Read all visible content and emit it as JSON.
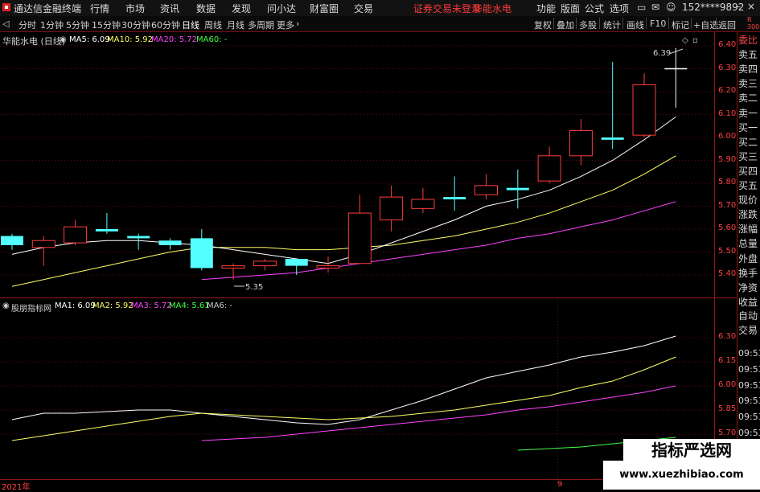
{
  "app": {
    "name": "通达信金融终端",
    "menu": [
      "行情",
      "市场",
      "资讯",
      "数据",
      "发现",
      "问小达",
      "财富圈",
      "交易"
    ],
    "warn": "证券交易未登录",
    "stock_tag": "华能水电",
    "right_menu": [
      "功能",
      "版面",
      "公式",
      "选项"
    ],
    "user": "152****9892"
  },
  "toolbar": {
    "periods": [
      "分时",
      "1分钟",
      "5分钟",
      "15分钟",
      "30分钟",
      "60分钟",
      "日线",
      "周线",
      "月线",
      "多周期",
      "更多"
    ],
    "active_period": "日线",
    "tools": [
      "复权",
      "叠加",
      "多股",
      "统计",
      "画线",
      "F10",
      "标记",
      "+自选",
      "返回"
    ],
    "badge_top": "R",
    "badge_bottom": "300"
  },
  "main_chart": {
    "stock_title": "华能水电 (日线)",
    "ma_legend": [
      {
        "label": "MA5: 6.09",
        "color": "#ffffff"
      },
      {
        "label": "MA10: 5.92",
        "color": "#ffff66"
      },
      {
        "label": "MA20: 5.72",
        "color": "#ff44ff"
      },
      {
        "label": "MA60: -",
        "color": "#44ff44"
      }
    ],
    "y_ticks": [
      "6.40",
      "6.30",
      "6.20",
      "6.10",
      "6.00",
      "5.90",
      "5.80",
      "5.70",
      "5.60",
      "5.50",
      "5.40"
    ],
    "high_label": "6.39",
    "low_label": "5.35"
  },
  "indicator": {
    "name": "股朋指标网",
    "legend": [
      {
        "label": "MA1: 6.09",
        "color": "#ffffff"
      },
      {
        "label": "MA2: 5.92",
        "color": "#ffff66"
      },
      {
        "label": "MA3: 5.72",
        "color": "#ff44ff"
      },
      {
        "label": "MA4: 5.61",
        "color": "#44ff44"
      },
      {
        "label": "MA6: -",
        "color": "#c8c8c8"
      }
    ],
    "y_ticks": [
      "6.30",
      "6.15",
      "6.00",
      "5.85",
      "5.70"
    ]
  },
  "bottom": {
    "year": "2021年",
    "marker": "9"
  },
  "side_panel": {
    "items": [
      "委比",
      "卖五",
      "卖四",
      "卖三",
      "卖二",
      "卖一",
      "买一",
      "买二",
      "买三",
      "买四",
      "买五",
      "现价",
      "涨跌",
      "涨幅",
      "总量",
      "外盘",
      "换手",
      "净资",
      "收益"
    ],
    "lower": [
      "自动",
      "交易"
    ],
    "times": [
      "09:53",
      "09:53",
      "09:53",
      "09:53",
      "09:53",
      "09:53",
      "09:53",
      "09:53",
      "09:53"
    ]
  },
  "watermark": {
    "title": "指标严选网",
    "url": "www.xuezhibiao.com"
  },
  "candles": [
    {
      "o": 5.57,
      "c": 5.53,
      "h": 5.58,
      "l": 5.51
    },
    {
      "o": 5.52,
      "c": 5.55,
      "h": 5.57,
      "l": 5.44
    },
    {
      "o": 5.54,
      "c": 5.61,
      "h": 5.64,
      "l": 5.53
    },
    {
      "o": 5.6,
      "c": 5.59,
      "h": 5.67,
      "l": 5.58
    },
    {
      "o": 5.57,
      "c": 5.56,
      "h": 5.58,
      "l": 5.51
    },
    {
      "o": 5.55,
      "c": 5.53,
      "h": 5.56,
      "l": 5.51
    },
    {
      "o": 5.56,
      "c": 5.43,
      "h": 5.6,
      "l": 5.42
    },
    {
      "o": 5.43,
      "c": 5.44,
      "h": 5.45,
      "l": 5.38
    },
    {
      "o": 5.44,
      "c": 5.46,
      "h": 5.47,
      "l": 5.42
    },
    {
      "o": 5.47,
      "c": 5.44,
      "h": 5.47,
      "l": 5.4
    },
    {
      "o": 5.43,
      "c": 5.44,
      "h": 5.48,
      "l": 5.41
    },
    {
      "o": 5.45,
      "c": 5.67,
      "h": 5.75,
      "l": 5.45
    },
    {
      "o": 5.64,
      "c": 5.74,
      "h": 5.79,
      "l": 5.59
    },
    {
      "o": 5.69,
      "c": 5.73,
      "h": 5.78,
      "l": 5.67
    },
    {
      "o": 5.74,
      "c": 5.73,
      "h": 5.83,
      "l": 5.68
    },
    {
      "o": 5.75,
      "c": 5.79,
      "h": 5.84,
      "l": 5.73
    },
    {
      "o": 5.78,
      "c": 5.77,
      "h": 5.86,
      "l": 5.69
    },
    {
      "o": 5.81,
      "c": 5.92,
      "h": 5.96,
      "l": 5.8
    },
    {
      "o": 5.92,
      "c": 6.03,
      "h": 6.08,
      "l": 5.88
    },
    {
      "o": 6.0,
      "c": 5.99,
      "h": 6.33,
      "l": 5.95
    },
    {
      "o": 6.01,
      "c": 6.23,
      "h": 6.28,
      "l": 6.0
    },
    {
      "o": 6.3,
      "c": 6.3,
      "h": 6.39,
      "l": 6.13
    }
  ],
  "ma5": [
    5.49,
    5.52,
    5.54,
    5.55,
    5.55,
    5.54,
    5.53,
    5.51,
    5.49,
    5.47,
    5.45,
    5.49,
    5.54,
    5.59,
    5.64,
    5.7,
    5.73,
    5.77,
    5.83,
    5.9,
    5.99,
    6.09
  ],
  "ma10": [
    5.35,
    5.38,
    5.41,
    5.44,
    5.47,
    5.5,
    5.52,
    5.52,
    5.52,
    5.51,
    5.51,
    5.52,
    5.53,
    5.55,
    5.57,
    5.6,
    5.63,
    5.67,
    5.72,
    5.77,
    5.84,
    5.92
  ],
  "ma20": [
    null,
    null,
    null,
    null,
    null,
    null,
    5.38,
    5.39,
    5.4,
    5.41,
    5.43,
    5.45,
    5.47,
    5.49,
    5.51,
    5.53,
    5.56,
    5.58,
    5.61,
    5.64,
    5.68,
    5.72
  ],
  "ind_ma1": [
    5.79,
    5.83,
    5.83,
    5.84,
    5.85,
    5.85,
    5.83,
    5.81,
    5.79,
    5.77,
    5.76,
    5.79,
    5.85,
    5.91,
    5.98,
    6.05,
    6.09,
    6.13,
    6.18,
    6.21,
    6.25,
    6.31
  ],
  "ind_ma2": [
    5.66,
    5.69,
    5.72,
    5.75,
    5.78,
    5.81,
    5.83,
    5.82,
    5.81,
    5.8,
    5.79,
    5.8,
    5.81,
    5.83,
    5.85,
    5.88,
    5.91,
    5.94,
    5.99,
    6.03,
    6.1,
    6.18
  ],
  "ind_ma3": [
    null,
    null,
    null,
    null,
    null,
    null,
    5.66,
    5.67,
    5.68,
    5.7,
    5.72,
    5.74,
    5.76,
    5.78,
    5.8,
    5.82,
    5.85,
    5.87,
    5.9,
    5.93,
    5.96,
    6.0
  ],
  "ind_ma4": [
    null,
    null,
    null,
    null,
    null,
    null,
    null,
    null,
    null,
    null,
    null,
    null,
    null,
    null,
    null,
    null,
    5.6,
    5.61,
    5.62,
    5.64,
    5.66,
    5.68
  ]
}
